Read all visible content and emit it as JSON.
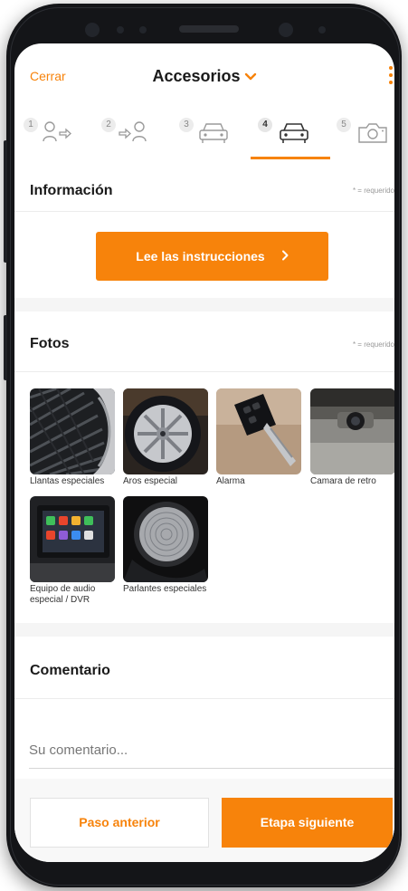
{
  "header": {
    "close_label": "Cerrar",
    "title": "Accesorios",
    "title_chevron": "chevron-down-icon",
    "menu_icon": "kebab-menu-icon"
  },
  "steps": [
    {
      "number": "1",
      "icon": "person-arrow-in-icon",
      "active": false
    },
    {
      "number": "2",
      "icon": "arrow-person-icon",
      "active": false
    },
    {
      "number": "3",
      "icon": "car-icon",
      "active": false
    },
    {
      "number": "4",
      "icon": "car-icon",
      "active": true
    },
    {
      "number": "5",
      "icon": "camera-icon",
      "active": false
    }
  ],
  "informacion": {
    "title": "Información",
    "required_note": "* = requerido",
    "instructions_button": "Lee las instrucciones"
  },
  "fotos": {
    "title": "Fotos",
    "required_note": "* = requerido",
    "items": [
      {
        "caption": "Llantas especiales",
        "image": "tire-photo"
      },
      {
        "caption": "Aros especial",
        "image": "rim-photo"
      },
      {
        "caption": "Alarma",
        "image": "car-key-alarm-photo"
      },
      {
        "caption": "Camara de retro",
        "image": "rear-camera-photo"
      },
      {
        "caption": "Equipo de audio especial / DVR",
        "image": "car-stereo-photo"
      },
      {
        "caption": "Parlantes especiales",
        "image": "speaker-photo"
      }
    ]
  },
  "comentario": {
    "title": "Comentario",
    "placeholder": "Su comentario..."
  },
  "footer": {
    "prev_label": "Paso anterior",
    "next_label": "Etapa siguiente"
  },
  "colors": {
    "accent": "#f7830b",
    "text": "#1a1a1a",
    "divider": "#ececec"
  }
}
